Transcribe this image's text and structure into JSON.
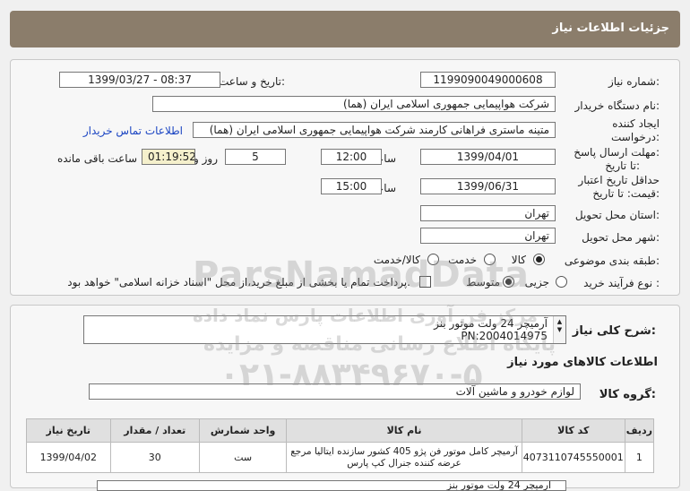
{
  "header": {
    "title": "جزئیات اطلاعات نیاز"
  },
  "form": {
    "need_number_label": "شماره نیاز:",
    "need_number": "1199090049000608",
    "announce_label": "تاریخ و ساعت اعلان عمومی:",
    "announce_value": "1399/03/27 - 08:37",
    "buyer_label": "نام دستگاه خریدار:",
    "buyer_value": "شرکت هواپیمایی جمهوری اسلامی ایران (هما)",
    "creator_label_1": "ایجاد کننده",
    "creator_label_2": "درخواست:",
    "creator_value": "متینه ماستری فراهانی کارمند شرکت هواپیمایی جمهوری اسلامی ایران (هما)",
    "contact_link": "اطلاعات تماس خریدار",
    "deadline_label_1": "مهلت ارسال پاسخ:",
    "deadline_label_2": "تا تاریخ:",
    "deadline_date": "1399/04/01",
    "time_label": "ساعت",
    "deadline_time": "12:00",
    "days_value": "5",
    "days_label": "روز و",
    "remaining_time": "01:19:52",
    "remaining_label": "ساعت باقی مانده",
    "validity_label_1": "حداقل تاریخ اعتبار",
    "validity_label_2": "قیمت: تا تاریخ:",
    "validity_date": "1399/06/31",
    "validity_time": "15:00",
    "province_label": "استان محل تحویل:",
    "province_value": "تهران",
    "city_label": "شهر محل تحویل:",
    "city_value": "تهران",
    "category_label": "طبقه بندی موضوعی:",
    "category_options": [
      "کالا",
      "خدمت",
      "کالا/خدمت"
    ],
    "process_label": "نوع فرآیند خرید :",
    "process_options": [
      "جزیی",
      "متوسط"
    ],
    "payment_note": "پرداخت تمام یا بخشی از مبلغ خرید،از محل \"اسناد خزانه اسلامی\" خواهد بود."
  },
  "need": {
    "description_label": "شرح کلی نیاز:",
    "description_line1": "آرمیچر 24 ولت موتور بنز",
    "description_line2": "PN:2004014975",
    "items_header": "اطلاعات کالاهای مورد نیاز",
    "group_label": "گروه کالا:",
    "group_value": "لوازم خودرو و ماشین آلات"
  },
  "table": {
    "headers": [
      "ردیف",
      "کد کالا",
      "نام کالا",
      "واحد شمارش",
      "تعداد / مقدار",
      "تاریخ نیاز"
    ],
    "rows": [
      {
        "row": "1",
        "code": "4073110745550001",
        "name_line1": "آرمیچر کامل موتور فن پژو 405 کشور سازنده ایتالیا مرجع",
        "name_line2": "عرضه کننده جنرال کپ پارس",
        "unit": "ست",
        "qty": "30",
        "date": "1399/04/02"
      }
    ]
  },
  "bottom": {
    "partial_text": "آرمیچر 24 ولت موتور بنز"
  },
  "watermark": {
    "line1": "ParsNamadData",
    "line2": "مرکز فن آوری اطلاعات پارس نماد داده",
    "line3": "پایگاه اطلاع رسانی مناقصه و مزایده",
    "line4": "۰۲۱-۸۸۳۴۹۶۷۰-۵"
  }
}
